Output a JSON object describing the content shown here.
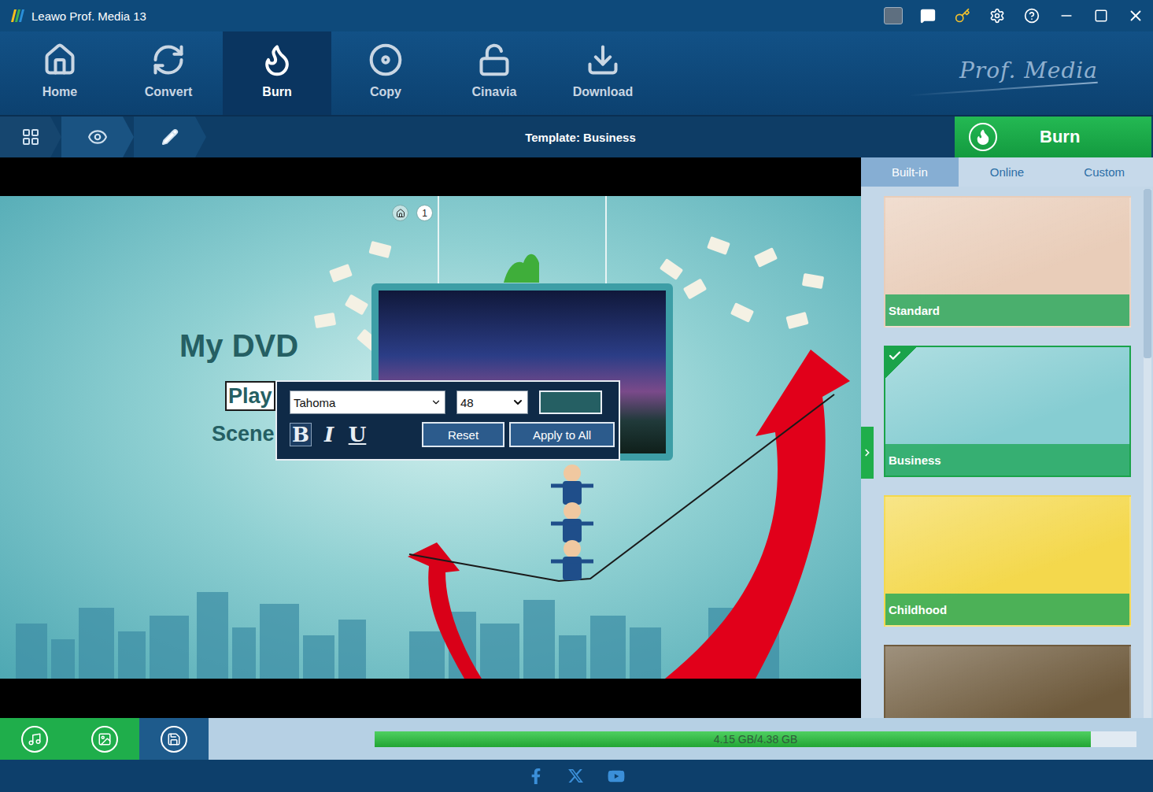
{
  "window": {
    "title": "Leawo Prof. Media 13"
  },
  "nav": [
    {
      "label": "Home",
      "selected": false
    },
    {
      "label": "Convert",
      "selected": false
    },
    {
      "label": "Burn",
      "selected": true
    },
    {
      "label": "Copy",
      "selected": false
    },
    {
      "label": "Cinavia",
      "selected": false
    },
    {
      "label": "Download",
      "selected": false
    }
  ],
  "brand": "Prof. Media",
  "toolbar": {
    "template_label": "Template: Business",
    "burn_button": "Burn"
  },
  "menu_preview": {
    "title": "My DVD",
    "page": "1",
    "items": [
      {
        "label": "Play",
        "selected": true
      },
      {
        "label": "Scene",
        "selected": false
      }
    ]
  },
  "font_editor": {
    "font": "Tahoma",
    "size": "48",
    "color": "#255f63",
    "styles": [
      {
        "label": "B",
        "kind": "bold",
        "on": true
      },
      {
        "label": "I",
        "kind": "italic",
        "on": false
      },
      {
        "label": "U",
        "kind": "underline",
        "on": false
      }
    ],
    "buttons": [
      "Reset",
      "Apply to All"
    ]
  },
  "template_tabs": [
    {
      "label": "Built-in",
      "selected": true
    },
    {
      "label": "Online",
      "selected": false
    },
    {
      "label": "Custom",
      "selected": false
    }
  ],
  "templates": [
    {
      "name": "Standard",
      "selected": false,
      "color": "#e9cdb9"
    },
    {
      "name": "Business",
      "selected": true,
      "color": "#86cdd2"
    },
    {
      "name": "Childhood",
      "selected": false,
      "color": "#f4d84c"
    },
    {
      "name": "",
      "selected": false,
      "color": "#6e5a3c"
    }
  ],
  "bottom_tools": [
    {
      "name": "music",
      "selected": false
    },
    {
      "name": "image",
      "selected": false
    },
    {
      "name": "save",
      "selected": true
    }
  ],
  "disc_usage": {
    "reading": "4.15 GB/4.38 GB",
    "level": 0.94
  }
}
